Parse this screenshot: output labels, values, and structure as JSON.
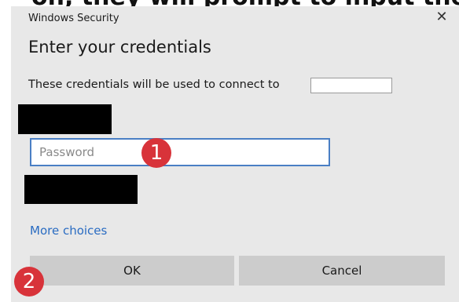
{
  "caption": {
    "text": "on, they will prompt to input the passw"
  },
  "dialog": {
    "window_title": "Windows Security",
    "close_glyph": "✕",
    "heading": "Enter your credentials",
    "description": "These credentials will be used to connect to",
    "password_placeholder": "Password",
    "more_choices_label": "More choices",
    "ok_label": "OK",
    "cancel_label": "Cancel"
  },
  "annotations": {
    "step1": "1",
    "step2": "2"
  },
  "colors": {
    "dialog_background": "#e8e8e8",
    "input_border_focus": "#4a7fc4",
    "link": "#2a6cc2",
    "button_background": "#cccccc",
    "badge": "#d8333a",
    "redaction": "#000000"
  },
  "icons": {
    "close": "close-icon"
  }
}
